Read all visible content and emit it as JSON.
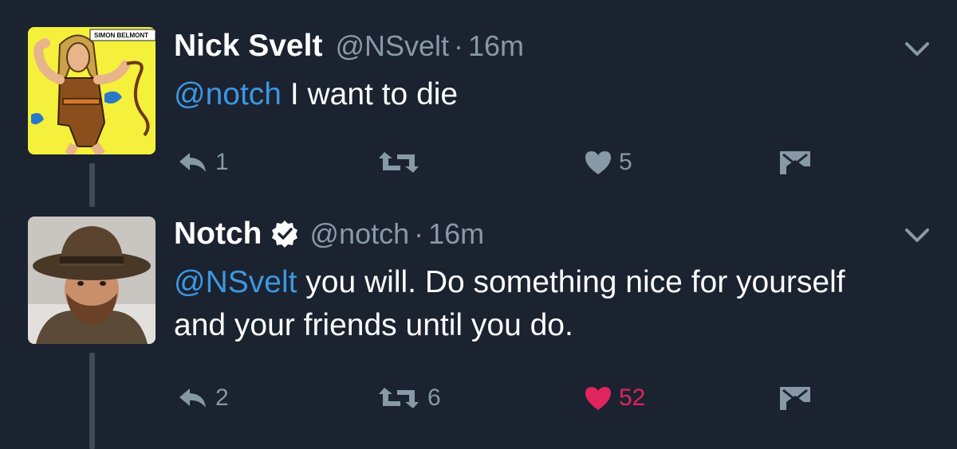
{
  "tweets": [
    {
      "name": "Nick Svelt",
      "handle": "@NSvelt",
      "separator": "·",
      "time": "16m",
      "verified": false,
      "mention": "@notch",
      "text": " I want to die",
      "avatar_caption": "SIMON BELMONT",
      "reply_count": "1",
      "retweet_count": "",
      "like_count": "5",
      "liked": false
    },
    {
      "name": "Notch",
      "handle": "@notch",
      "separator": "·",
      "time": "16m",
      "verified": true,
      "mention": "@NSvelt",
      "text": " you will. Do something nice for yourself and your friends until you do.",
      "reply_count": "2",
      "retweet_count": "6",
      "like_count": "52",
      "liked": true
    }
  ],
  "icons": {
    "reply": "reply-icon",
    "retweet": "retweet-icon",
    "like": "heart-icon",
    "dm": "direct-message-icon",
    "more": "chevron-down-icon",
    "verified": "verified-badge-icon"
  },
  "colors": {
    "background": "#1b2230",
    "mention": "#3d97e0",
    "muted": "#8899a6",
    "liked": "#e0245e",
    "thread_line": "#3f4b5b"
  }
}
